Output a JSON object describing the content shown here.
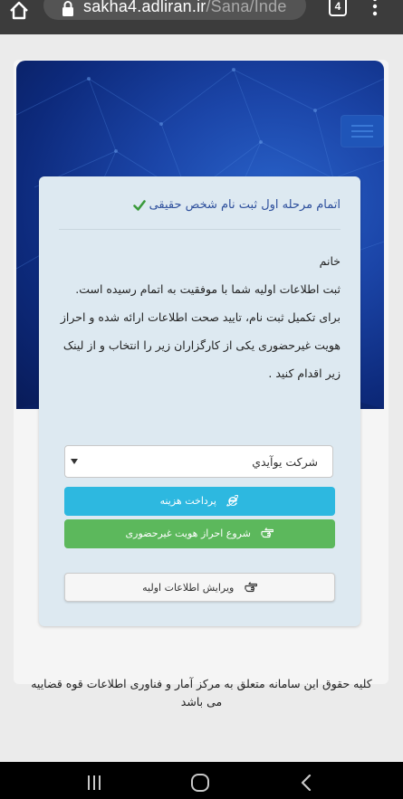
{
  "browser": {
    "url_host": "sakha4.adliran.ir",
    "url_path": "/Sana/Inde",
    "tab_count": "4",
    "icons": {
      "home": "home-icon",
      "lock": "lock-icon",
      "menu": "kebab-menu-icon"
    }
  },
  "header": {
    "nav_toggle_icon": "hamburger-icon"
  },
  "card": {
    "title": "اتمام مرحله اول ثبت نام شخص حقیقی",
    "title_icon": "check-icon",
    "title_color": "#2d4f9c",
    "check_color": "#3a9a3a",
    "message": {
      "line1": "خانم",
      "line2": "ثبت اطلاعات اولیه شما با موفقیت به اتمام رسیده است.",
      "line3": "برای تکمیل ثبت نام، تایید صحت اطلاعات ارائه شده و احراز هویت غیرحضوری یکی از کارگزاران زیر را انتخاب و از لینک زیر اقدام کنید ."
    },
    "provider_select": {
      "selected": "شرکت یوآیدي"
    },
    "buttons": {
      "pay": {
        "label": "پرداخت هزینه",
        "icon": "internet-explorer-icon",
        "color": "#2db8e0"
      },
      "verify": {
        "label": "شروع احراز هویت غیرحضوری",
        "icon": "hand-pointer-icon",
        "color": "#5cb85c"
      },
      "edit": {
        "label": "ویرایش اطلاعات اولیه",
        "icon": "hand-pointer-icon"
      }
    }
  },
  "footer": {
    "copyright": "کلیه حقوق این سامانه متعلق به مرکز آمار و فناوری اطلاعات قوه قضاییه می باشد"
  },
  "android_nav": {
    "icons": [
      "recents-icon",
      "home-circle-icon",
      "back-icon"
    ]
  }
}
